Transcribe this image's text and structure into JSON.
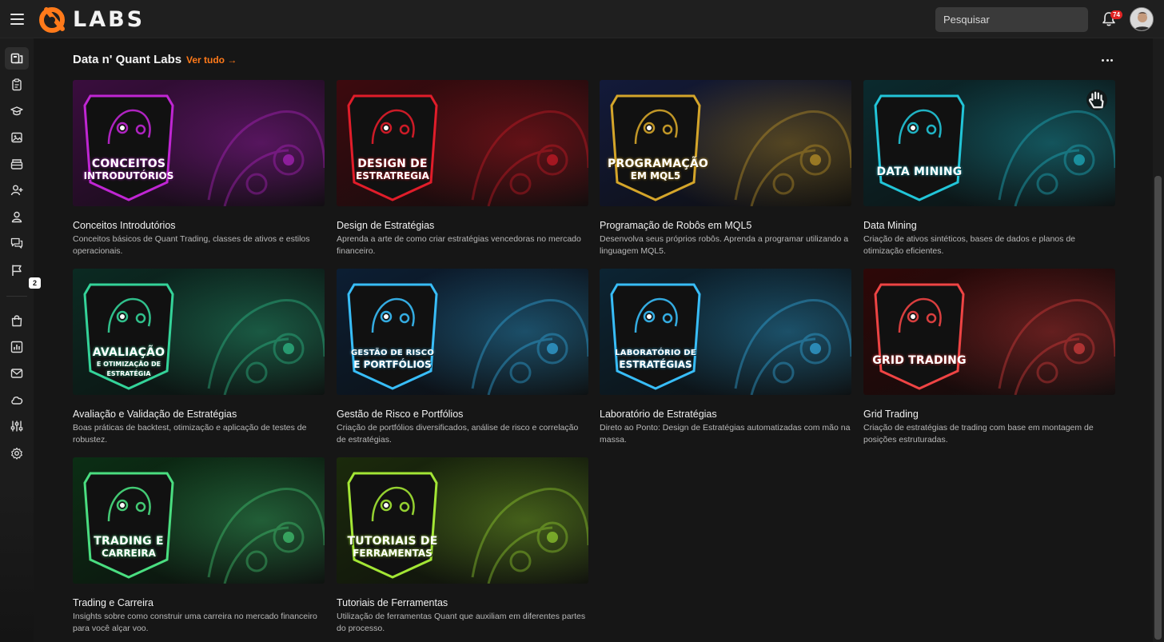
{
  "app": {
    "brand": "LABS",
    "accent_color": "#ff7a1a"
  },
  "header": {
    "search_placeholder": "Pesquisar",
    "notification_count": "74"
  },
  "sidebar": {
    "items": [
      {
        "icon": "courses-icon"
      },
      {
        "icon": "clipboard-icon"
      },
      {
        "icon": "graduation-cap-icon"
      },
      {
        "icon": "image-icon"
      },
      {
        "icon": "archive-icon"
      },
      {
        "icon": "add-user-icon"
      },
      {
        "icon": "users-icon"
      },
      {
        "icon": "chat-icon",
        "badge": "2"
      },
      {
        "icon": "flag-icon"
      },
      {
        "icon": "shopping-bag-icon"
      },
      {
        "icon": "chart-icon"
      },
      {
        "icon": "mail-icon"
      },
      {
        "icon": "cloud-icon"
      },
      {
        "icon": "sliders-icon"
      },
      {
        "icon": "gear-icon"
      }
    ]
  },
  "section": {
    "title": "Data n' Quant Labs",
    "see_all": "Ver tudo →"
  },
  "cards": [
    {
      "title": "Conceitos Introdutórios",
      "description": "Conceitos básicos de Quant Trading, classes de ativos e estilos operacionais.",
      "badge_line1": "CONCEITOS",
      "badge_line2": "INTRODUTÓRIOS",
      "theme": "#c026d3",
      "bg": "#3a0d3e"
    },
    {
      "title": "Design de Estratégias",
      "description": "Aprenda a arte de como criar estratégias vencedoras no mercado financeiro.",
      "badge_line1": "DESIGN DE",
      "badge_line2": "ESTRATREGIA",
      "theme": "#e11d2a",
      "bg": "#3d0a0e"
    },
    {
      "title": "Programação de Robôs em MQL5",
      "description": "Desenvolva seus próprios robôs. Aprenda a programar utilizando a linguagem MQL5.",
      "badge_line1": "PROGRAMAÇÃO",
      "badge_line2": "EM MQL5",
      "theme": "#d4a52a",
      "bg": "#131a3a"
    },
    {
      "title": "Data Mining",
      "description": "Criação de ativos sintéticos, bases de dados e planos de otimização eficientes.",
      "badge_line1": "DATA MINING",
      "badge_line2": "",
      "theme": "#22c5d8",
      "bg": "#0b2a2e"
    },
    {
      "title": "Avaliação e Validação de Estratégias",
      "description": "Boas práticas de backtest, otimização e aplicação de testes de robustez.",
      "badge_line1": "AVALIAÇÃO",
      "badge_line2": "E OTIMIZAÇÃO DE ESTRATÉGIA",
      "theme": "#34d399",
      "bg": "#0b2a22"
    },
    {
      "title": "Gestão de Risco e Portfólios",
      "description": "Criação de portfólios diversificados, análise de risco e correlação de estratégias.",
      "badge_line1": "GESTÃO DE RISCO",
      "badge_line2": "E PORTFÓLIOS",
      "theme": "#38bdf8",
      "bg": "#0c1e33"
    },
    {
      "title": "Laboratório de Estratégias",
      "description": "Direto ao Ponto: Design de Estratégias automatizadas com mão na massa.",
      "badge_line1": "LABORATÓRIO DE",
      "badge_line2": "ESTRATÉGIAS",
      "theme": "#38bdf8",
      "bg": "#0c2433"
    },
    {
      "title": "Grid Trading",
      "description": "Criação de estratégias de trading com base em montagem de posições estruturadas.",
      "badge_line1": "GRID TRADING",
      "badge_line2": "",
      "theme": "#ef4444",
      "bg": "#2e0808"
    },
    {
      "title": "Trading e Carreira",
      "description": "Insights sobre como construir uma carreira no mercado financeiro para você alçar voo.",
      "badge_line1": "TRADING E",
      "badge_line2": "CARREIRA",
      "theme": "#4ade80",
      "bg": "#0b2e14"
    },
    {
      "title": "Tutoriais de Ferramentas",
      "description": "Utilização de ferramentas Quant que auxiliam em diferentes partes do processo.",
      "badge_line1": "TUTORIAIS DE",
      "badge_line2": "FERRAMENTAS",
      "theme": "#a3e635",
      "bg": "#1b2a0c"
    }
  ]
}
